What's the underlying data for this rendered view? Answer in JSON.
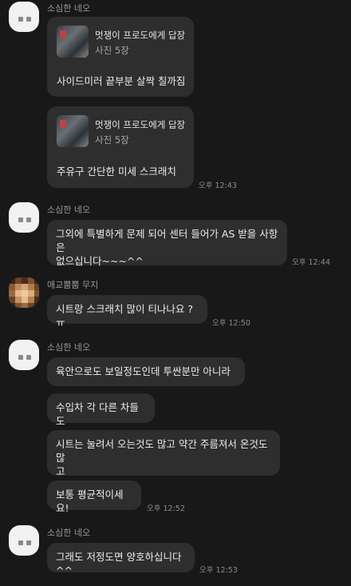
{
  "messages": {
    "g1": {
      "sender": "소심한 네오",
      "reply1": {
        "title": "멋쟁이 프로도에게 답장",
        "subtitle": "사진 5장",
        "text": "사이드미러 끝부분 살짝 칠까짐"
      },
      "reply2": {
        "title": "멋쟁이 프로도에게 답장",
        "subtitle": "사진 5장",
        "text": "주유구 간단한 미세 스크래치"
      },
      "time": "오후 12:43"
    },
    "g2": {
      "sender": "소심한 네오",
      "text_line1": "그외에 특별하게 문제 되어 센터 들어가 AS 받을 사항은",
      "text_line2": "없으십니다~~~^^",
      "time": "오후 12:44"
    },
    "g3": {
      "sender": "애교뿜뿜 무지",
      "text": "시트랑 스크래치 많이 티나나요 ? ㅠ",
      "time": "오후 12:50"
    },
    "g4": {
      "sender": "소심한 네오",
      "m1": "육안으로도 보일정도인데 투싼분만 아니라",
      "m2": "수입차 각 다른 차들도",
      "m3_line1": "시트는 눌려서 오는것도 많고 약간 주름져서 온것도 많",
      "m3_line2": "고",
      "m4": "보통 평균적이세요!",
      "time": "오후 12:52"
    },
    "g5": {
      "sender": "소심한 네오",
      "text": "그래도 저정도면 양호하십니다^^",
      "time": "오후 12:53"
    }
  },
  "colors": {
    "background": "#181818",
    "bubble": "#2e2e2e",
    "name": "#9a9a9a",
    "time": "#8d8d8d"
  }
}
